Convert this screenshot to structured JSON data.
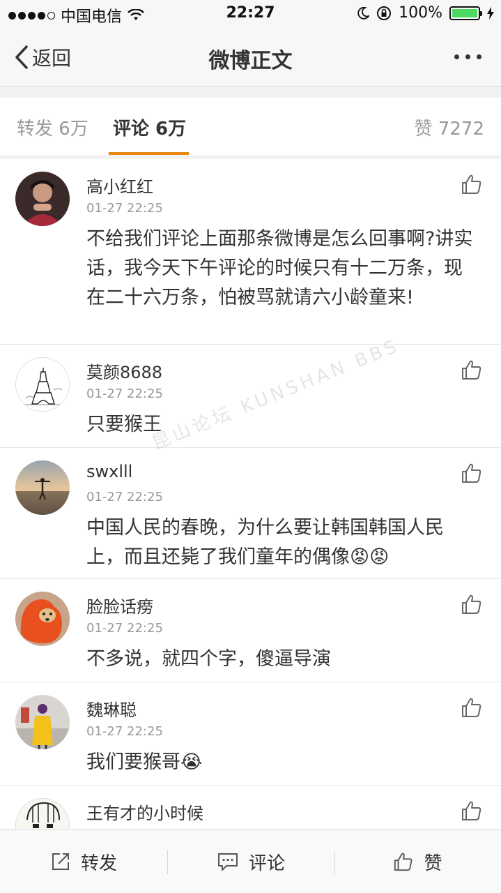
{
  "status_bar": {
    "carrier": "中国电信",
    "time": "22:27",
    "battery": "100%"
  },
  "nav": {
    "back_label": "返回",
    "title": "微博正文"
  },
  "tabs": {
    "repost": "转发 6万",
    "comment": "评论 6万",
    "like": "赞 7272"
  },
  "comments": [
    {
      "name": "高小红红",
      "time": "01-27 22:25",
      "text": "不给我们评论上面那条微博是怎么回事啊?讲实话，我今天下午评论的时候只有十二万条，现在二十六万条，怕被骂就请六小龄童来!"
    },
    {
      "name": "莫颜8688",
      "time": "01-27 22:25",
      "text": "只要猴王"
    },
    {
      "name": "swxlll",
      "time": "01-27 22:25",
      "text": "中国人民的春晚，为什么要让韩国韩国人民上，而且还毙了我们童年的偶像"
    },
    {
      "name": "脸脸话痨",
      "time": "01-27 22:25",
      "text": "不多说，就四个字，傻逼导演"
    },
    {
      "name": "魏琳聪",
      "time": "01-27 22:25",
      "text": "我们要猴哥"
    },
    {
      "name": "王有才的小时候",
      "time": "",
      "text": ""
    }
  ],
  "emoji": {
    "angry": "😡",
    "crying": "😭"
  },
  "toolbar": {
    "repost": "转发",
    "comment": "评论",
    "like": "赞"
  },
  "watermark": "昆山论坛 KUNSHAN BBS",
  "colors": {
    "accent": "#e8870f",
    "text": "#333333",
    "muted": "#999999"
  }
}
